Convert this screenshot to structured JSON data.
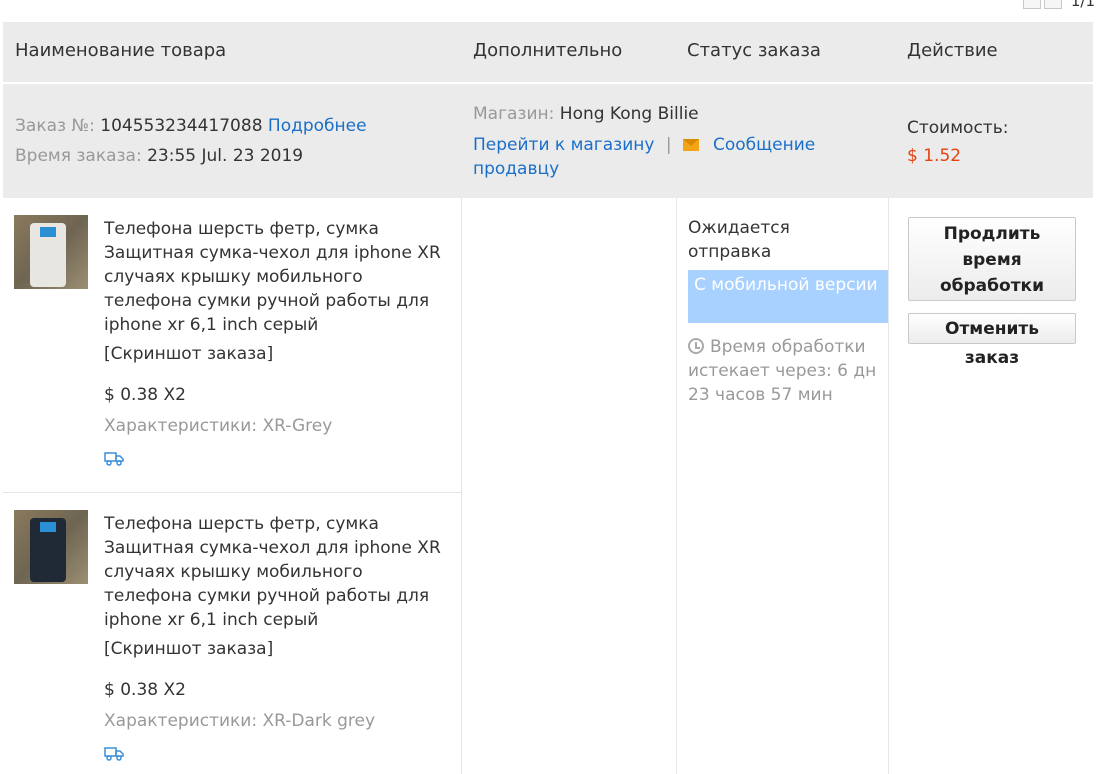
{
  "pager": {
    "text": "1/1"
  },
  "table_header": {
    "product": "Наименование товара",
    "additional": "Дополнительно",
    "status": "Статус заказа",
    "action": "Действие"
  },
  "order": {
    "number_label": "Заказ №:",
    "number": "104553234417088",
    "details_link": "Подробнее",
    "time_label": "Время заказа:",
    "time": "23:55 Jul. 23 2019",
    "store_label": "Магазин:",
    "store_name": "Hong Kong Billie",
    "go_to_store": "Перейти к магазину",
    "separator": "|",
    "message_seller_1": "Сообщение",
    "message_seller_2": "продавцу",
    "cost_label": "Стоимость:",
    "cost": "$ 1.52"
  },
  "products": [
    {
      "title": "Телефона шерсть фетр, сумка Защитная сумка-чехол для iphone XR случаях крышку мобильного телефона сумки ручной работы для iphone xr 6,1 inch серый",
      "snapshot": "[Скриншот заказа]",
      "price": "$ 0.38 X2",
      "attributes": "Характеристики: XR-Grey",
      "pouch_color": "#e8e6e0"
    },
    {
      "title": "Телефона шерсть фетр, сумка Защитная сумка-чехол для iphone XR случаях крышку мобильного телефона сумки ручной работы для iphone xr 6,1 inch серый",
      "snapshot": "[Скриншот заказа]",
      "price": "$ 0.38 X2",
      "attributes": "Характеристики: XR-Dark grey",
      "pouch_color": "#1f2a36"
    }
  ],
  "status": {
    "text": "Ожидается отправка",
    "mobile_badge": "С мобильной версии",
    "timer": "Время обработки истекает через: 6 дн 23 часов 57 мин"
  },
  "actions": {
    "extend": "Продлить время обработки",
    "cancel": "Отменить заказ"
  },
  "colors": {
    "link": "#1a6fc9",
    "price": "#e4430f",
    "header_bg": "#ebebeb",
    "badge_bg": "#a9d1ff"
  },
  "icons": [
    "envelope-icon",
    "clock-icon",
    "truck-icon"
  ]
}
